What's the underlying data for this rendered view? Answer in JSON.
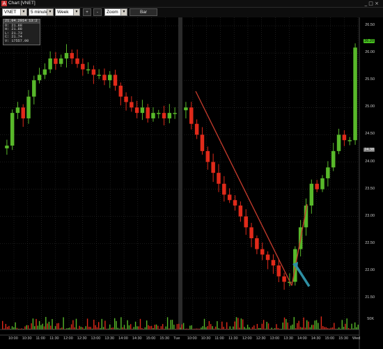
{
  "window": {
    "title": "Chart [VNET]",
    "controls": "_ □ ×"
  },
  "toolbar": {
    "symbol": "VNET",
    "interval": "5 minutes",
    "period": "Week",
    "zoom_in": "+",
    "zoom_out": "-",
    "zoom_mode": "Zoom",
    "chart_style": "Bar"
  },
  "info": {
    "header": "21.04.2014 13:2",
    "open": "O: 21.88",
    "high": "H: 21.88",
    "low": "L: 21.73",
    "close": "C: 21.74",
    "volume": "V: 17557.00"
  },
  "price_tags": {
    "last": "26.20",
    "marker": "24.38"
  },
  "volume_tick": "50K",
  "colors": {
    "up": "#58b82a",
    "down": "#e02a1a",
    "trendline": "#c0392b",
    "arrow": "#2e8fa3",
    "grid": "#3a3a3a"
  },
  "chart_data": {
    "type": "bar",
    "symbol": "VNET",
    "interval": "5 minutes",
    "y_axis": {
      "ticks": [
        26.5,
        26.0,
        25.5,
        25.0,
        24.5,
        24.0,
        23.5,
        23.0,
        22.5,
        22.0,
        21.5
      ],
      "range": [
        21.35,
        26.65
      ]
    },
    "x_axis": {
      "ticks": [
        "10:00",
        "10:30",
        "11:00",
        "11:30",
        "12:00",
        "12:30",
        "13:00",
        "13:30",
        "14:00",
        "14:30",
        "15:00",
        "15:30",
        "Tue",
        "10:00",
        "10:30",
        "11:00",
        "11:30",
        "12:00",
        "12:30",
        "13:00",
        "13:30",
        "14:00",
        "14:30",
        "15:00",
        "15:30",
        "Wed"
      ]
    },
    "grid": true,
    "session_close": [
      [
        24.3,
        24.9,
        25.0,
        24.8,
        25.2,
        25.5,
        25.6,
        25.7,
        25.9,
        25.8,
        25.9,
        26.0,
        25.9,
        25.8,
        25.7,
        25.7,
        25.6,
        25.6,
        25.5,
        25.6,
        25.4,
        25.2,
        25.1,
        25.0,
        24.9,
        25.0,
        24.8,
        24.9,
        24.9,
        24.8,
        24.9,
        24.9
      ],
      [
        25.0,
        24.7,
        24.5,
        24.2,
        24.0,
        23.8,
        23.6,
        23.4,
        23.3,
        23.2,
        23.0,
        22.8,
        22.6,
        22.4,
        22.3,
        22.2,
        22.1,
        21.9,
        21.8,
        21.8,
        22.4,
        22.8,
        23.2,
        23.6,
        23.5,
        23.7,
        23.9,
        24.2,
        24.5,
        24.4,
        24.4,
        26.1
      ]
    ],
    "volume_max_k": 60
  }
}
